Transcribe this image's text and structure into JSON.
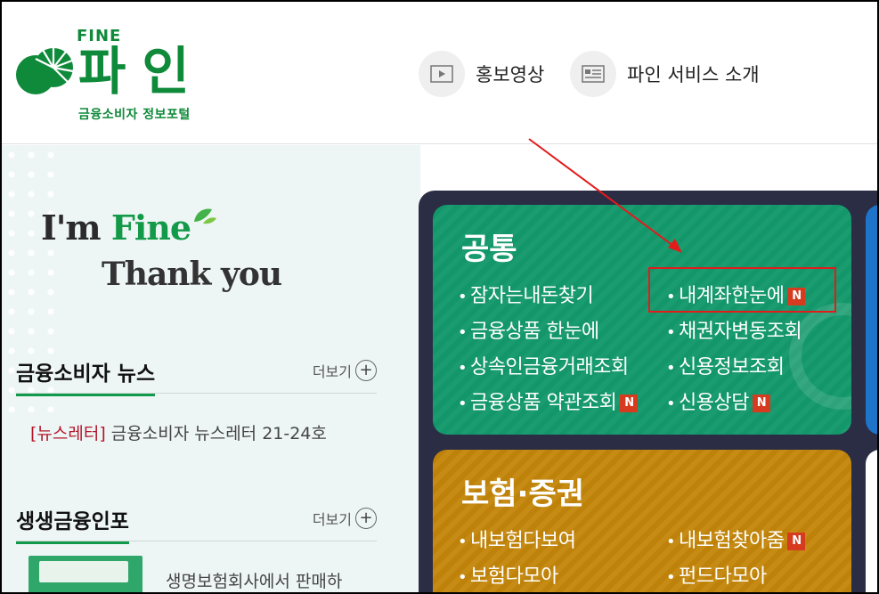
{
  "header": {
    "logo": {
      "fine": "FINE",
      "name": "파인",
      "subtitle": "금융소비자 정보포털"
    },
    "buttons": [
      {
        "label": "홍보영상",
        "icon": "play-icon"
      },
      {
        "label": "파인 서비스 소개",
        "icon": "document-icon"
      }
    ]
  },
  "slogan": {
    "line1a": "I'm ",
    "line1b": "Fine",
    "line2": "Thank you"
  },
  "news": {
    "title": "금융소비자 뉴스",
    "more": "더보기",
    "item_tag": "[뉴스레터]",
    "item_text": " 금융소비자 뉴스레터 21-24호"
  },
  "info": {
    "title": "생생금융인포",
    "more": "더보기",
    "item_text": "생명보험회사에서 판매하"
  },
  "cards": {
    "common": {
      "title": "공통",
      "items": [
        {
          "label": "잠자는내돈찾기",
          "new": false
        },
        {
          "label": "내계좌한눈에",
          "new": true
        },
        {
          "label": "금융상품 한눈에",
          "new": false
        },
        {
          "label": "채권자변동조회",
          "new": false
        },
        {
          "label": "상속인금융거래조회",
          "new": false
        },
        {
          "label": "신용정보조회",
          "new": false
        },
        {
          "label": "금융상품 약관조회",
          "new": true
        },
        {
          "label": "신용상담",
          "new": true
        }
      ]
    },
    "insurance": {
      "title": "보험·증권",
      "items": [
        {
          "label": "내보험다보여",
          "new": false
        },
        {
          "label": "내보험찾아줌",
          "new": true
        },
        {
          "label": "보험다모아",
          "new": false
        },
        {
          "label": "펀드다모아",
          "new": false
        }
      ]
    },
    "new_badge": "N"
  },
  "colors": {
    "brand": "#0f8a3a",
    "green_card": "#13996b",
    "orange_card": "#c4860a",
    "board": "#2b2d45",
    "annotation": "#e31b1b"
  }
}
